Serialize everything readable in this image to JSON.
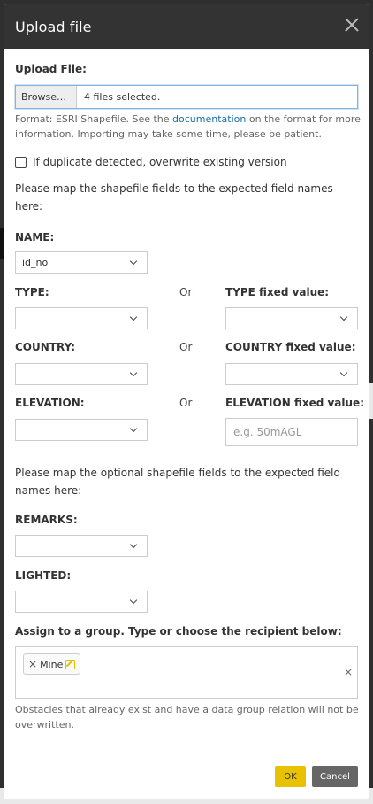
{
  "dialog": {
    "title": "Upload file"
  },
  "upload": {
    "label": "Upload File:",
    "browse_label": "Browse…",
    "status": "4 files selected."
  },
  "help": {
    "line1_pre": "Format: ESRI Shapefile. See the ",
    "line1_link": "documentation",
    "line1_post": " on the format for more",
    "line2": "information. Importing may take some time, please be patient."
  },
  "overwrite": {
    "label": "If duplicate detected, overwrite existing version",
    "checked": false
  },
  "mapping": {
    "intro_line1": "Please map the shapefile fields to the expected field names",
    "intro_line2": "here:",
    "or_label": "Or",
    "fields": [
      {
        "label": "NAME:",
        "value": "id_no"
      },
      {
        "label": "TYPE:",
        "value": "",
        "fixed_label": "TYPE fixed value:",
        "fixed_value": ""
      },
      {
        "label": "COUNTRY:",
        "value": "",
        "fixed_label": "COUNTRY fixed value:",
        "fixed_value": ""
      },
      {
        "label": "ELEVATION:",
        "value": "",
        "fixed_label": "ELEVATION fixed value:",
        "fixed_placeholder": "e.g. 50mAGL"
      }
    ]
  },
  "optional": {
    "intro_line1": "Please map the optional shapefile fields to the expected field",
    "intro_line2": "names here:",
    "fields": [
      {
        "label": "REMARKS:",
        "value": ""
      },
      {
        "label": "LIGHTED:",
        "value": ""
      }
    ]
  },
  "group": {
    "label": "Assign to a group. Type or choose the recipient below:",
    "chips": [
      "Mine"
    ],
    "note_line1": "Obstacles that already exist and have a data group relation will not be",
    "note_line2": "overwritten."
  },
  "footer": {
    "ok_label": "OK",
    "cancel_label": "Cancel"
  },
  "colors": {
    "header_bg": "#333333",
    "ok_bg": "#e8c200",
    "cancel_bg": "#666666",
    "link": "#1a6fa6"
  }
}
